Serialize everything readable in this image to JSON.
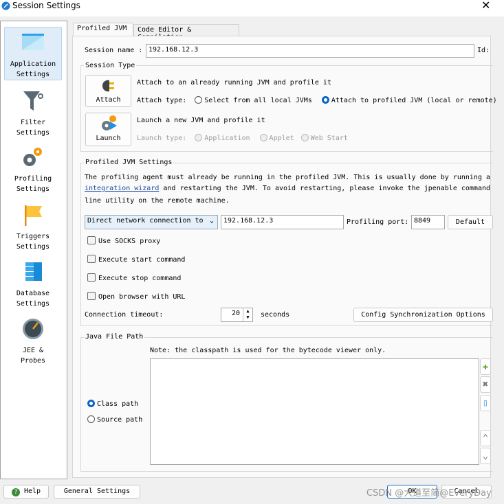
{
  "window": {
    "title": "Session Settings"
  },
  "sidebar": {
    "items": [
      {
        "label1": "Application",
        "label2": "Settings",
        "icon": "application-window-icon",
        "selected": true
      },
      {
        "label1": "Filter",
        "label2": "Settings",
        "icon": "funnel-icon"
      },
      {
        "label1": "Profiling",
        "label2": "Settings",
        "icon": "gears-icon"
      },
      {
        "label1": "Triggers",
        "label2": "Settings",
        "icon": "flag-icon"
      },
      {
        "label1": "Database",
        "label2": "Settings",
        "icon": "database-icon"
      },
      {
        "label1": "JEE &",
        "label2": "Probes",
        "icon": "gauge-icon"
      }
    ]
  },
  "tabs": [
    {
      "label": "Profiled JVM",
      "selected": true
    },
    {
      "label": "Code Editor & Compilation"
    }
  ],
  "session": {
    "name_label": "Session name :",
    "name_value": "192.168.12.3",
    "id_label": "Id:"
  },
  "session_type": {
    "title": "Session Type",
    "attach_button": "Attach",
    "attach_desc": "Attach to an already running JVM and profile it",
    "attach_type_label": "Attach type:",
    "attach_opt1": "Select from all local JVMs",
    "attach_opt2": "Attach to profiled JVM (local or remote)",
    "launch_button": "Launch",
    "launch_desc": "Launch a new JVM and profile it",
    "launch_type_label": "Launch type:",
    "launch_opt1": "Application",
    "launch_opt2": "Applet",
    "launch_opt3": "Web Start"
  },
  "jvm_settings": {
    "title": "Profiled JVM Settings",
    "desc1": "The profiling agent must already be running in the profiled JVM. This is usually done by running an",
    "desc_link": "integration wizard",
    "desc2": " and restarting the JVM. To avoid restarting, please invoke the jpenable command",
    "desc3": "line utility on the remote machine.",
    "connection_type": "Direct network connection to",
    "host": "192.168.12.3",
    "port_label": "Profiling port:",
    "port_value": "8849",
    "default_button": "Default",
    "socks": "Use SOCKS proxy",
    "start_cmd": "Execute start command",
    "stop_cmd": "Execute stop command",
    "browser": "Open browser with URL",
    "timeout_label": "Connection timeout:",
    "timeout_value": "20",
    "timeout_unit": "seconds",
    "sync_button": "Config Synchronization Options"
  },
  "java_path": {
    "title": "Java File Path",
    "note": "Note: the classpath is used for the bytecode viewer only.",
    "class_path": "Class path",
    "source_path": "Source path",
    "selected": "Class path"
  },
  "footer": {
    "help": "Help",
    "general": "General Settings",
    "ok": "OK",
    "cancel": "Cancel"
  },
  "watermark": "CSDN @大道至简@EveryDay",
  "colors": {
    "accent": "#0a64c8",
    "selection": "#e0ecf8"
  }
}
